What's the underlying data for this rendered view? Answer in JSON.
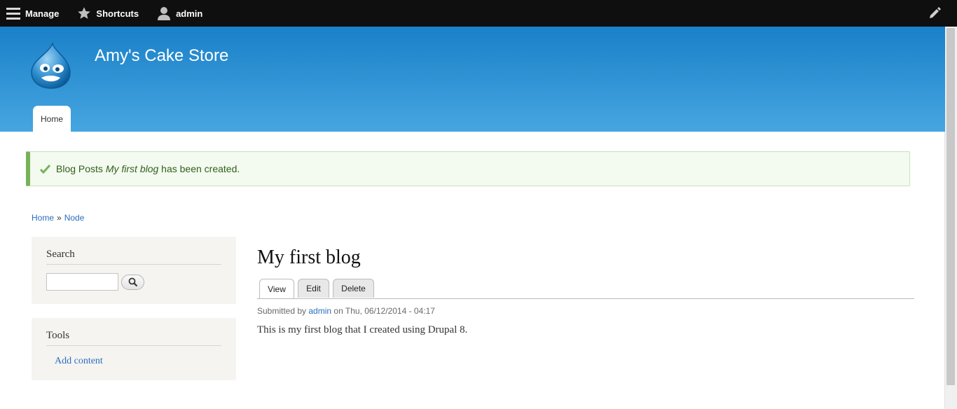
{
  "toolbar": {
    "manage_label": "Manage",
    "shortcuts_label": "Shortcuts",
    "user_label": "admin"
  },
  "header": {
    "site_name": "Amy's Cake Store",
    "nav_tab": "Home"
  },
  "message": {
    "prefix": "Blog Posts ",
    "title": "My first blog",
    "suffix": " has been created."
  },
  "breadcrumb": {
    "home": "Home",
    "separator": "»",
    "node": "Node"
  },
  "sidebar": {
    "search": {
      "title": "Search",
      "input_value": ""
    },
    "tools": {
      "title": "Tools",
      "add_content": "Add content"
    }
  },
  "main": {
    "title": "My first blog",
    "tabs": [
      {
        "label": "View"
      },
      {
        "label": "Edit"
      },
      {
        "label": "Delete"
      }
    ],
    "submitted": {
      "prefix": "Submitted by ",
      "author": "admin",
      "suffix": " on Thu, 06/12/2014 - 04:17"
    },
    "body": "This is my first blog that I created using Drupal 8."
  },
  "colors": {
    "toolbar_bg": "#0f0f0f",
    "header_top": "#1a80c8",
    "header_bottom": "#46a6e0",
    "link": "#2a6ebb",
    "status_green": "#77b259"
  }
}
